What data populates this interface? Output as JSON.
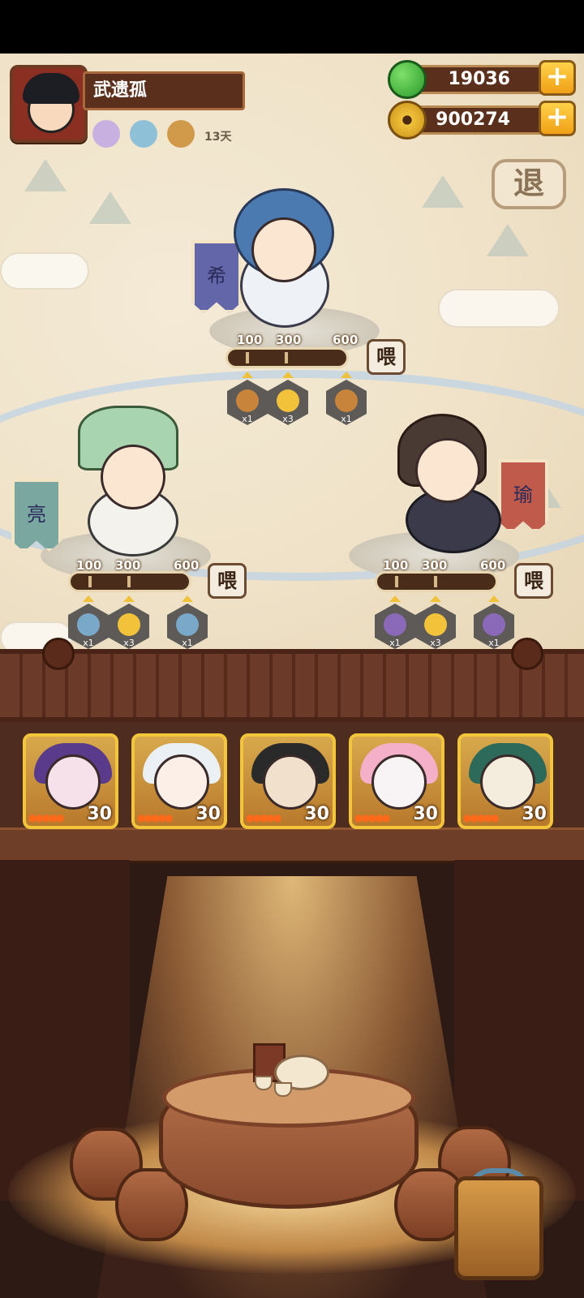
{
  "player": {
    "name": "武遗孤",
    "buff_days": "13天",
    "buffs": [
      "character-buff-icon",
      "bowl-buff-icon",
      "key-buff-icon"
    ]
  },
  "currencies": {
    "green": {
      "icon": "green-apple-icon",
      "value": "19036"
    },
    "coin": {
      "icon": "copper-coin-icon",
      "value": "900274"
    }
  },
  "buttons": {
    "plus": "+",
    "exit": "退",
    "feed": "喂"
  },
  "heroes": [
    {
      "banner": "希",
      "thresholds": [
        "100",
        "300",
        "600"
      ],
      "requirements": [
        {
          "icon": "key-icon",
          "count": "x1",
          "color": "#c8843a"
        },
        {
          "icon": "yellow-bag-icon",
          "count": "x3",
          "color": "#f2c23a"
        },
        {
          "icon": "key-icon",
          "count": "x1",
          "color": "#c8843a"
        }
      ]
    },
    {
      "banner": "亮",
      "thresholds": [
        "100",
        "300",
        "600"
      ],
      "requirements": [
        {
          "icon": "bowl-icon",
          "count": "x1",
          "color": "#7aa8c8"
        },
        {
          "icon": "yellow-bag-icon",
          "count": "x3",
          "color": "#f2c23a"
        },
        {
          "icon": "bowl-icon",
          "count": "x1",
          "color": "#7aa8c8"
        }
      ]
    },
    {
      "banner": "瑜",
      "thresholds": [
        "100",
        "300",
        "600"
      ],
      "requirements": [
        {
          "icon": "character-icon",
          "count": "x1",
          "color": "#8a6ab8"
        },
        {
          "icon": "yellow-bag-icon",
          "count": "x3",
          "color": "#f2c23a"
        },
        {
          "icon": "character-icon",
          "count": "x1",
          "color": "#8a6ab8"
        }
      ]
    }
  ],
  "cards": [
    {
      "level": "30",
      "stars": "●●●●●",
      "face": "#f6e0ea",
      "hair": "#5a3a8a"
    },
    {
      "level": "30",
      "stars": "●●●●●",
      "face": "#fbefe8",
      "hair": "#eaf0f4"
    },
    {
      "level": "30",
      "stars": "●●●●●",
      "face": "#f0e0cc",
      "hair": "#2a2a2a"
    },
    {
      "level": "30",
      "stars": "●●●●●",
      "face": "#f8f4f6",
      "hair": "#f4b0c8"
    },
    {
      "level": "30",
      "stars": "●●●●●",
      "face": "#f4ecdc",
      "hair": "#2e6a5a"
    }
  ]
}
